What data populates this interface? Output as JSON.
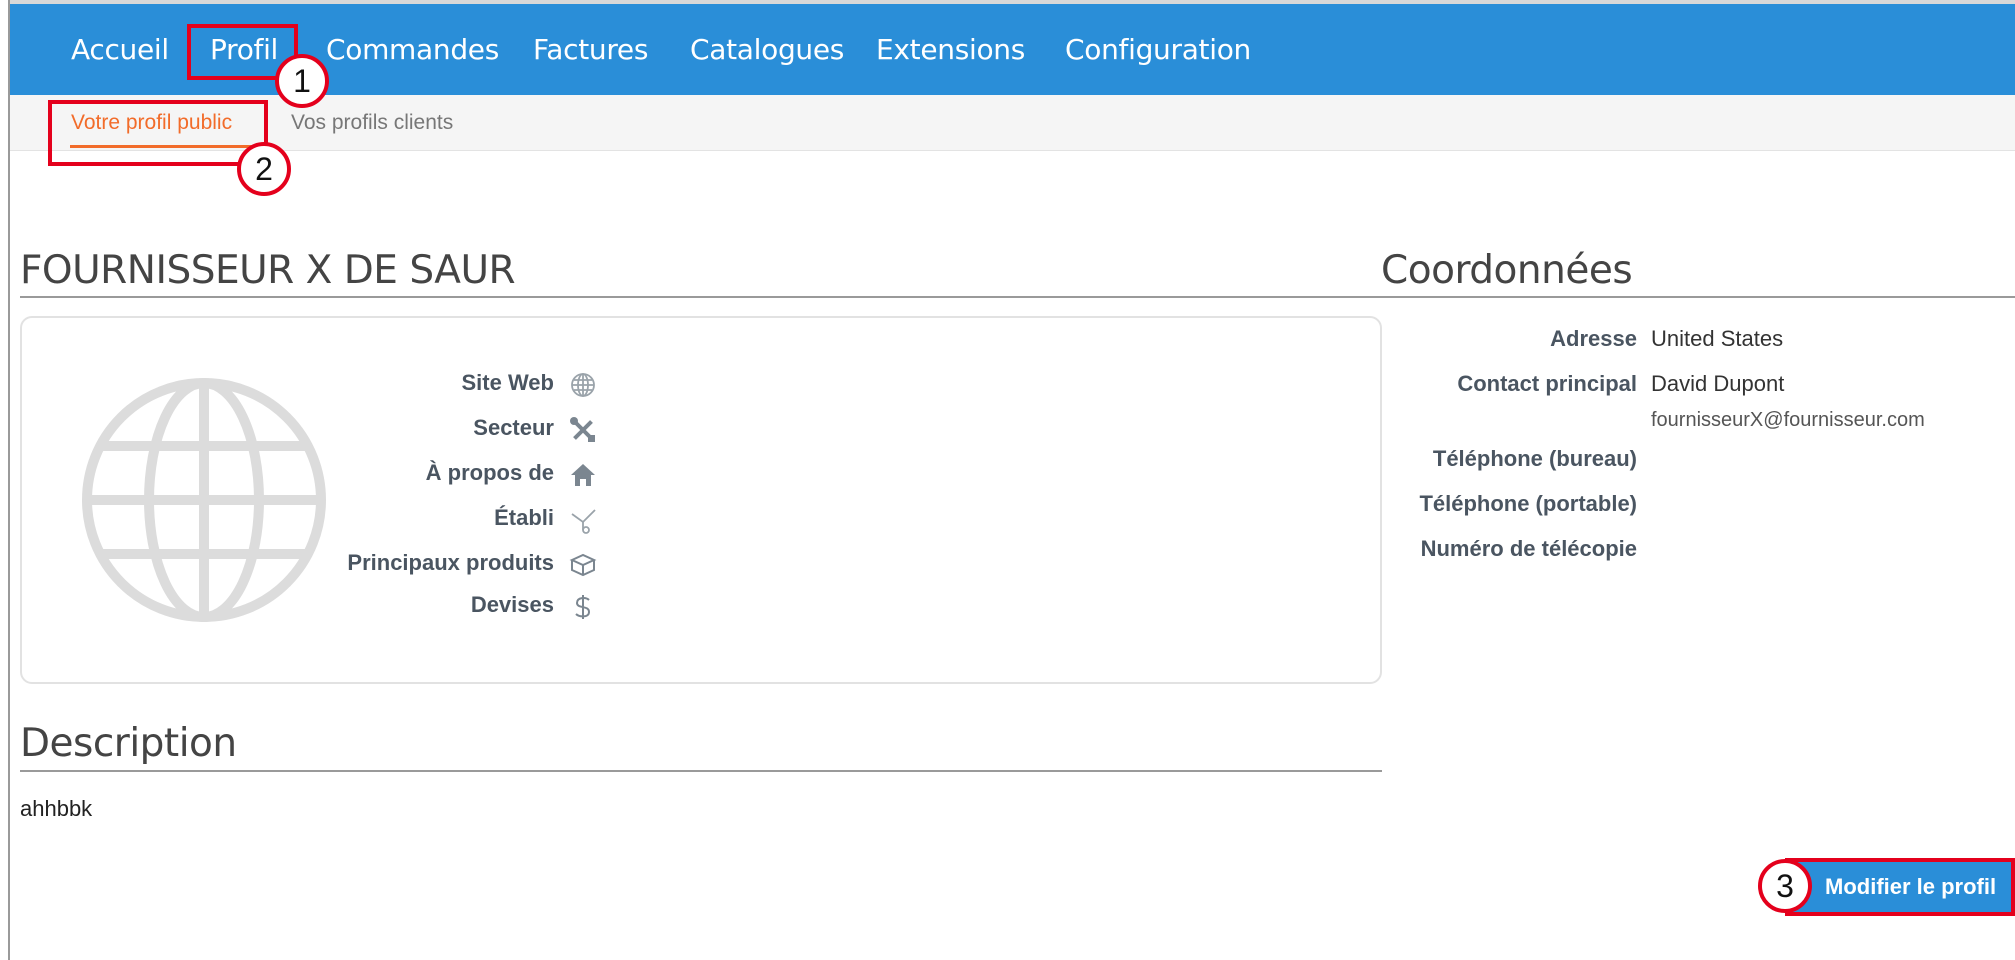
{
  "topnav": {
    "items": [
      {
        "label": "Accueil"
      },
      {
        "label": "Profil"
      },
      {
        "label": "Commandes"
      },
      {
        "label": "Factures"
      },
      {
        "label": "Catalogues"
      },
      {
        "label": "Extensions"
      },
      {
        "label": "Configuration"
      }
    ]
  },
  "subnav": {
    "items": [
      {
        "label": "Votre profil public",
        "active": true
      },
      {
        "label": "Vos profils clients",
        "active": false
      }
    ]
  },
  "annotations": {
    "one": "1",
    "two": "2",
    "three": "3"
  },
  "company": {
    "name": "FOURNISSEUR X DE SAUR",
    "fields": [
      {
        "label": "Site Web",
        "icon": "globe-icon"
      },
      {
        "label": "Secteur",
        "icon": "tools-icon"
      },
      {
        "label": "À propos de",
        "icon": "home-icon"
      },
      {
        "label": "Établi",
        "icon": "established-icon"
      },
      {
        "label": "Principaux produits",
        "icon": "boxes-icon"
      },
      {
        "label": "Devises",
        "icon": "dollar-icon"
      }
    ],
    "logo_icon": "globe-icon"
  },
  "coordonnees": {
    "heading": "Coordonnées",
    "adresse_label": "Adresse",
    "adresse_value": "United States",
    "contact_label": "Contact principal",
    "contact_value": "David Dupont",
    "contact_email": "fournisseurX@fournisseur.com",
    "tel_bureau_label": "Téléphone (bureau)",
    "tel_portable_label": "Téléphone (portable)",
    "fax_label": "Numéro de télécopie"
  },
  "description": {
    "heading": "Description",
    "text": "ahhbbk"
  },
  "actions": {
    "edit_label": "Modifier le profil"
  },
  "colors": {
    "nav_blue": "#2a8ed8",
    "active_orange": "#f26c2a",
    "annotation_red": "#e4001c"
  }
}
